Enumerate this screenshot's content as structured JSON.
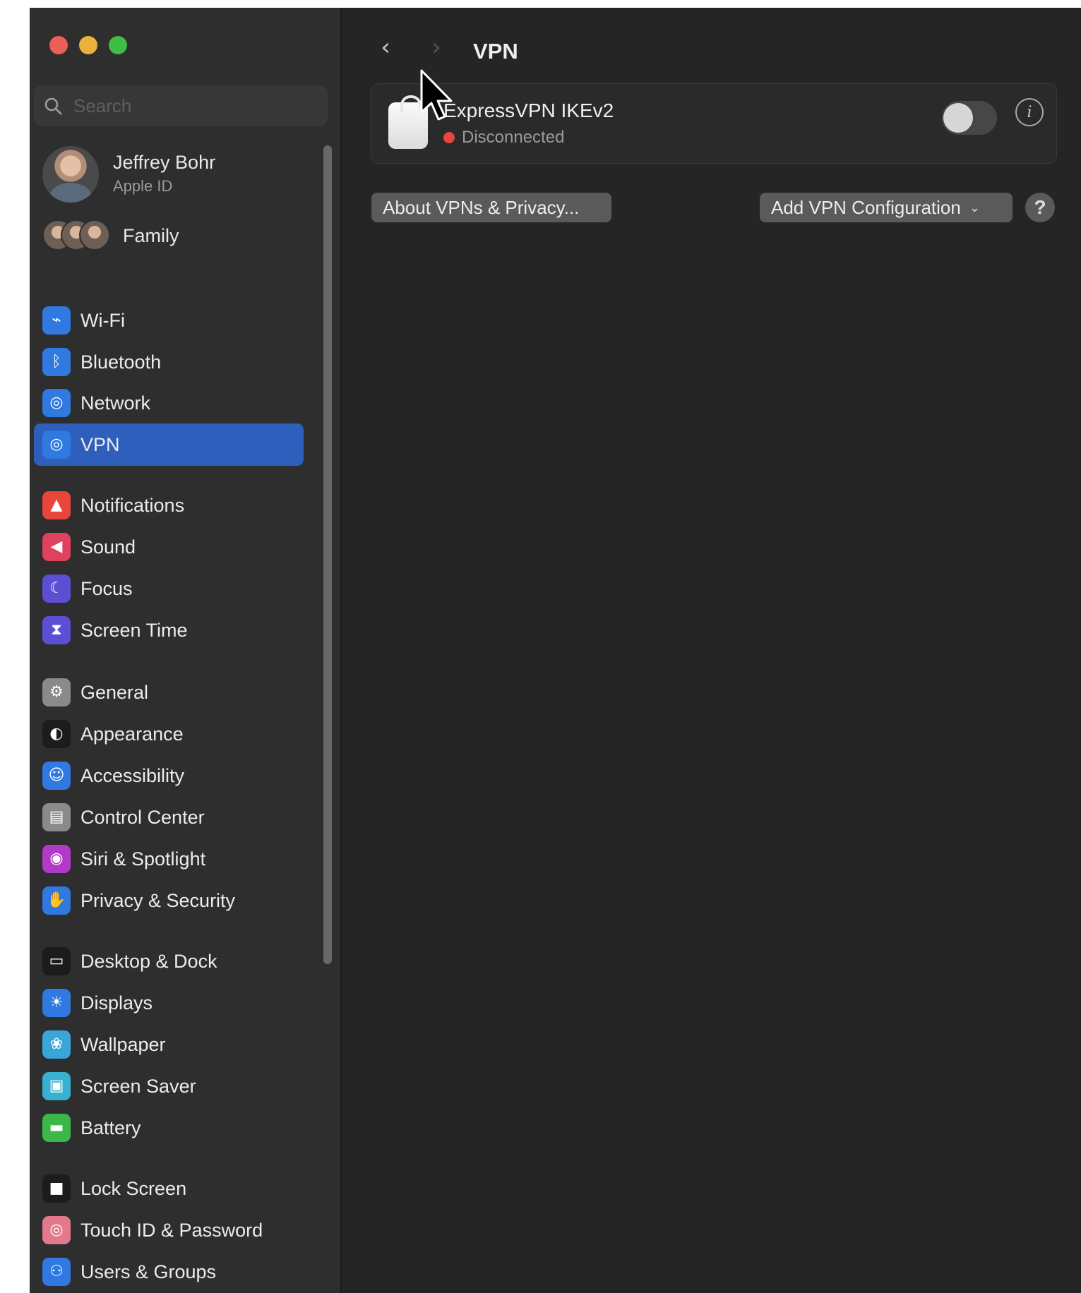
{
  "search": {
    "placeholder": "Search"
  },
  "profile": {
    "name": "Jeffrey Bohr",
    "subtitle": "Apple ID"
  },
  "family": {
    "label": "Family"
  },
  "sidebar": {
    "items": [
      {
        "label": "Wi-Fi",
        "icon": "wifi-icon",
        "color": "#2f79e0"
      },
      {
        "label": "Bluetooth",
        "icon": "bluetooth-icon",
        "color": "#2f79e0"
      },
      {
        "label": "Network",
        "icon": "globe-icon",
        "color": "#2f79e0"
      },
      {
        "label": "VPN",
        "icon": "vpn-globe-icon",
        "color": "#2f79e0",
        "selected": true
      },
      {
        "label": "Notifications",
        "icon": "bell-icon",
        "color": "#e8453c"
      },
      {
        "label": "Sound",
        "icon": "speaker-icon",
        "color": "#e0415e"
      },
      {
        "label": "Focus",
        "icon": "moon-icon",
        "color": "#5c4fd4"
      },
      {
        "label": "Screen Time",
        "icon": "hourglass-icon",
        "color": "#5c4fd4"
      },
      {
        "label": "General",
        "icon": "gear-icon",
        "color": "#8a8a8a"
      },
      {
        "label": "Appearance",
        "icon": "appearance-icon",
        "color": "#1c1c1c"
      },
      {
        "label": "Accessibility",
        "icon": "accessibility-icon",
        "color": "#2f79e0"
      },
      {
        "label": "Control Center",
        "icon": "control-center-icon",
        "color": "#8a8a8a"
      },
      {
        "label": "Siri & Spotlight",
        "icon": "siri-icon",
        "color": "#b23ac9"
      },
      {
        "label": "Privacy & Security",
        "icon": "hand-icon",
        "color": "#2f79e0"
      },
      {
        "label": "Desktop & Dock",
        "icon": "dock-icon",
        "color": "#1c1c1c"
      },
      {
        "label": "Displays",
        "icon": "sun-icon",
        "color": "#2f79e0"
      },
      {
        "label": "Wallpaper",
        "icon": "wallpaper-icon",
        "color": "#38a7d8"
      },
      {
        "label": "Screen Saver",
        "icon": "screen-saver-icon",
        "color": "#3ab0d0"
      },
      {
        "label": "Battery",
        "icon": "battery-icon",
        "color": "#3cb84a"
      },
      {
        "label": "Lock Screen",
        "icon": "lock-icon",
        "color": "#1c1c1c"
      },
      {
        "label": "Touch ID & Password",
        "icon": "fingerprint-icon",
        "color": "#e37a8c"
      },
      {
        "label": "Users & Groups",
        "icon": "users-icon",
        "color": "#2f79e0"
      }
    ]
  },
  "header": {
    "title": "VPN"
  },
  "vpn": {
    "name": "ExpressVPN IKEv2",
    "status": "Disconnected",
    "status_color": "#e8453c",
    "enabled": false
  },
  "buttons": {
    "about": "About VPNs & Privacy...",
    "add": "Add VPN Configuration",
    "help": "?"
  }
}
